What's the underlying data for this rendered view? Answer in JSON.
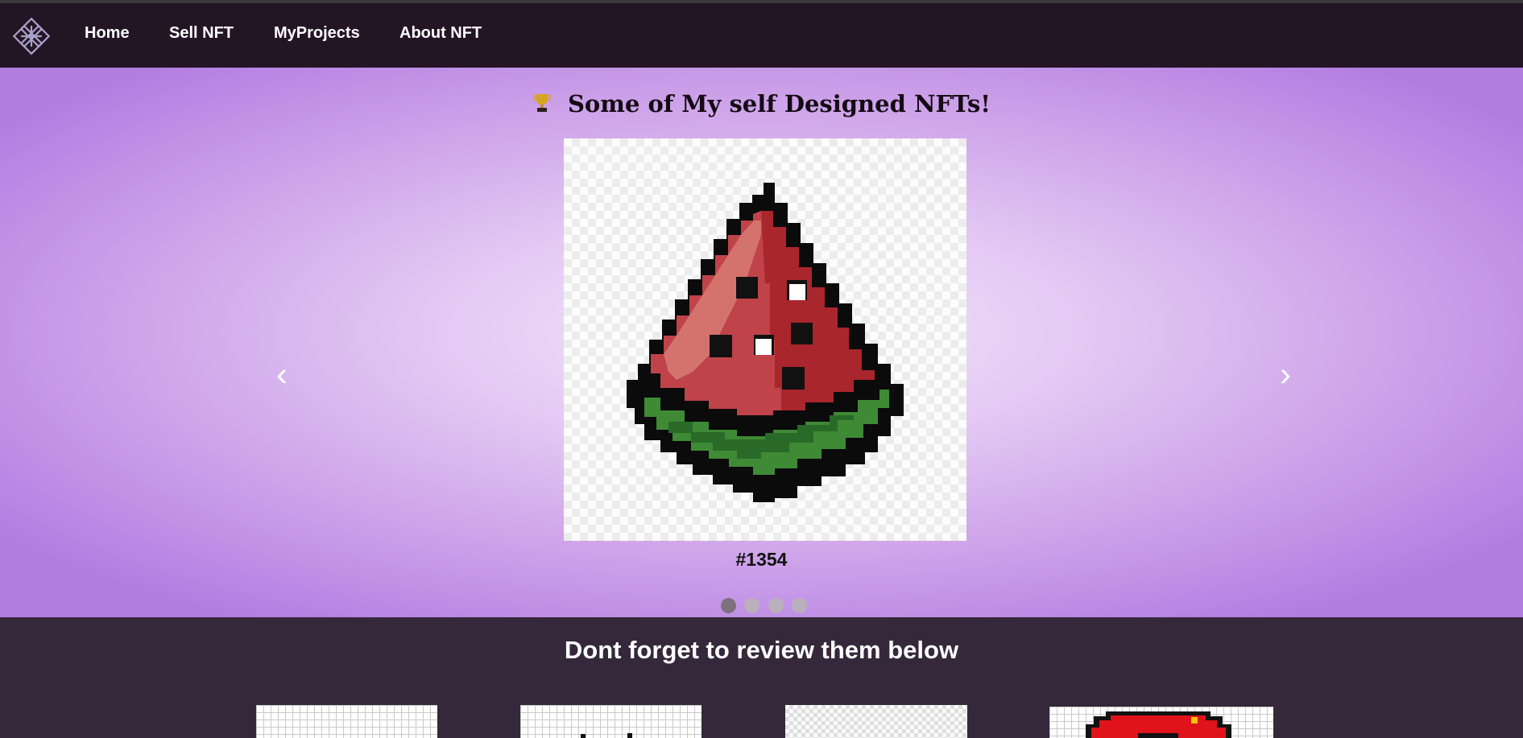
{
  "nav": {
    "logo_icon": "knot-logo-icon",
    "links": [
      "Home",
      "Sell NFT",
      "MyProjects",
      "About NFT"
    ]
  },
  "hero": {
    "title_icon": "trophy-icon",
    "title": "Some of My self Designed NFTs!",
    "slide_image": "pixel-watermelon-slice",
    "caption": "#1354",
    "prev_arrow": "‹",
    "next_arrow": "›",
    "slide_count": 4,
    "active_slide": 1
  },
  "reviews": {
    "heading": "Dont forget to review them below",
    "thumbnails": [
      "grid-pixel-art-1",
      "grid-pixel-art-2",
      "checker-pixel-art",
      "red-pixel-art"
    ]
  },
  "colors": {
    "navbar_bg": "#241525",
    "page_bg": "#34283a",
    "hero_center": "#f3e7fb",
    "hero_edge": "#b37ee2",
    "dot_active": "#7b727d",
    "dot_inactive": "#b9b0bc"
  }
}
